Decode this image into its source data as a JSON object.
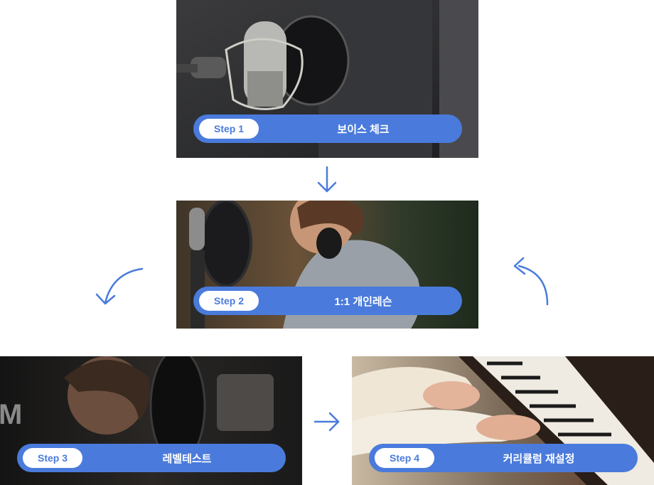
{
  "accent_color": "#4a7bdc",
  "steps": [
    {
      "badge": "Step 1",
      "label": "보이스 체크",
      "image": "microphone-photo"
    },
    {
      "badge": "Step 2",
      "label": "1:1 개인레슨",
      "image": "singer-with-headphones-photo"
    },
    {
      "badge": "Step 3",
      "label": "레벨테스트",
      "image": "singer-at-mic-photo",
      "watermark": "M"
    },
    {
      "badge": "Step 4",
      "label": "커리큘럼 재설정",
      "image": "piano-playing-photo"
    }
  ],
  "arrows": [
    "arrow-down-icon",
    "arrow-curve-down-left-icon",
    "arrow-right-icon",
    "arrow-curve-up-left-icon"
  ]
}
